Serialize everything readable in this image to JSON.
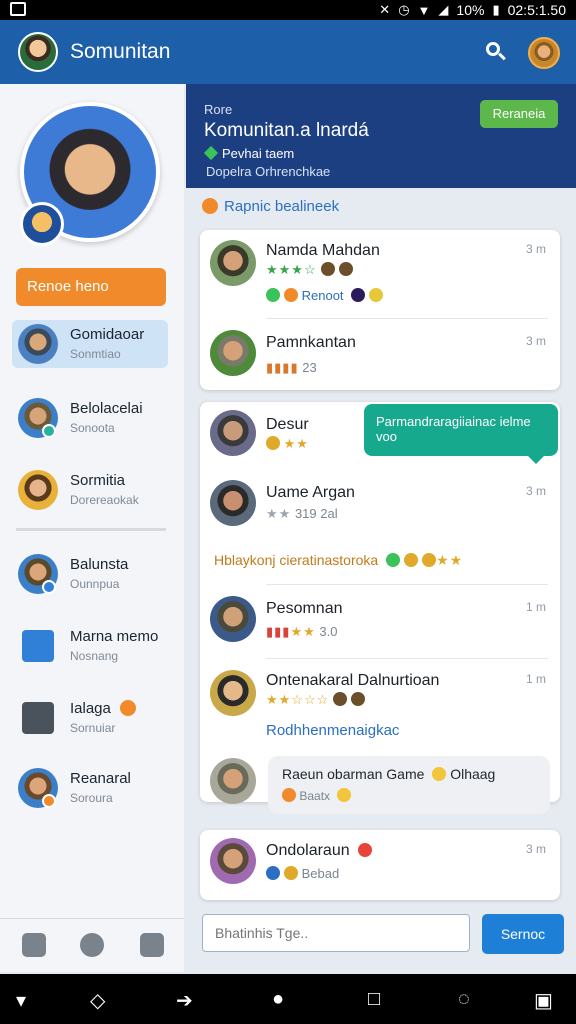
{
  "status_bar": {
    "battery_text": "10%",
    "time": "02:5:1.50"
  },
  "app": {
    "title": "Somunitan"
  },
  "sidebar": {
    "cta_label": "Renoe heno",
    "items": [
      {
        "name": "Gomidaoar",
        "sub": "Sonmtiao"
      },
      {
        "name": "Belolacelai",
        "sub": "Sonoota"
      },
      {
        "name": "Sormitia",
        "sub": "Dorereaokak"
      },
      {
        "name": "Balunsta",
        "sub": "Ounnpua"
      },
      {
        "name": "Marna memo",
        "sub": "Nosnang"
      },
      {
        "name": "Ialaga",
        "sub": "Sornuiar"
      },
      {
        "name": "Reanaral",
        "sub": "Soroura"
      }
    ]
  },
  "header": {
    "eyebrow": "Rore",
    "name": "Komunitan.a lnardá",
    "line1": "Pevhai taem",
    "line2": "Dopelra Orhrenchkae",
    "follow_label": "Reraneia"
  },
  "feed": {
    "section_label": "Rapnic bealineek",
    "posts": [
      {
        "name": "Namda Mahdan",
        "meta": "Renoot",
        "time": "3 m"
      },
      {
        "name": "Pamnkantan",
        "meta": "23",
        "time": "3 m"
      },
      {
        "name": "Desur",
        "meta": "",
        "time": ""
      },
      {
        "name": "Uame Argan",
        "meta": "319 2al",
        "time": "3 m"
      },
      {
        "name": "Pesomnan",
        "meta": "3.0",
        "time": "1 m"
      },
      {
        "name": "Ontenakaral Dalnurtioan",
        "meta": "",
        "time": "1 m"
      },
      {
        "name": "Ondolaraun",
        "meta": "Bebad",
        "time": "3 m"
      }
    ],
    "bubble_text": "Parmandraragiiainac ielme voo",
    "banner_text": "Hblaykonj cieratinastoroka",
    "link_text": "Rodhhenmenaigkac",
    "quote_text": "Raeun obarman Game",
    "quote_suffix": "Olhaag",
    "quote_meta": "Baatx"
  },
  "composer": {
    "placeholder": "Bhatinhis Tge..",
    "send_label": "Sernoc"
  },
  "colors": {
    "primary": "#1d5fa8",
    "accent": "#f08a2a",
    "header_panel": "#1c3f82",
    "follow_green": "#5cb84b",
    "bubble_teal": "#17a98e"
  }
}
